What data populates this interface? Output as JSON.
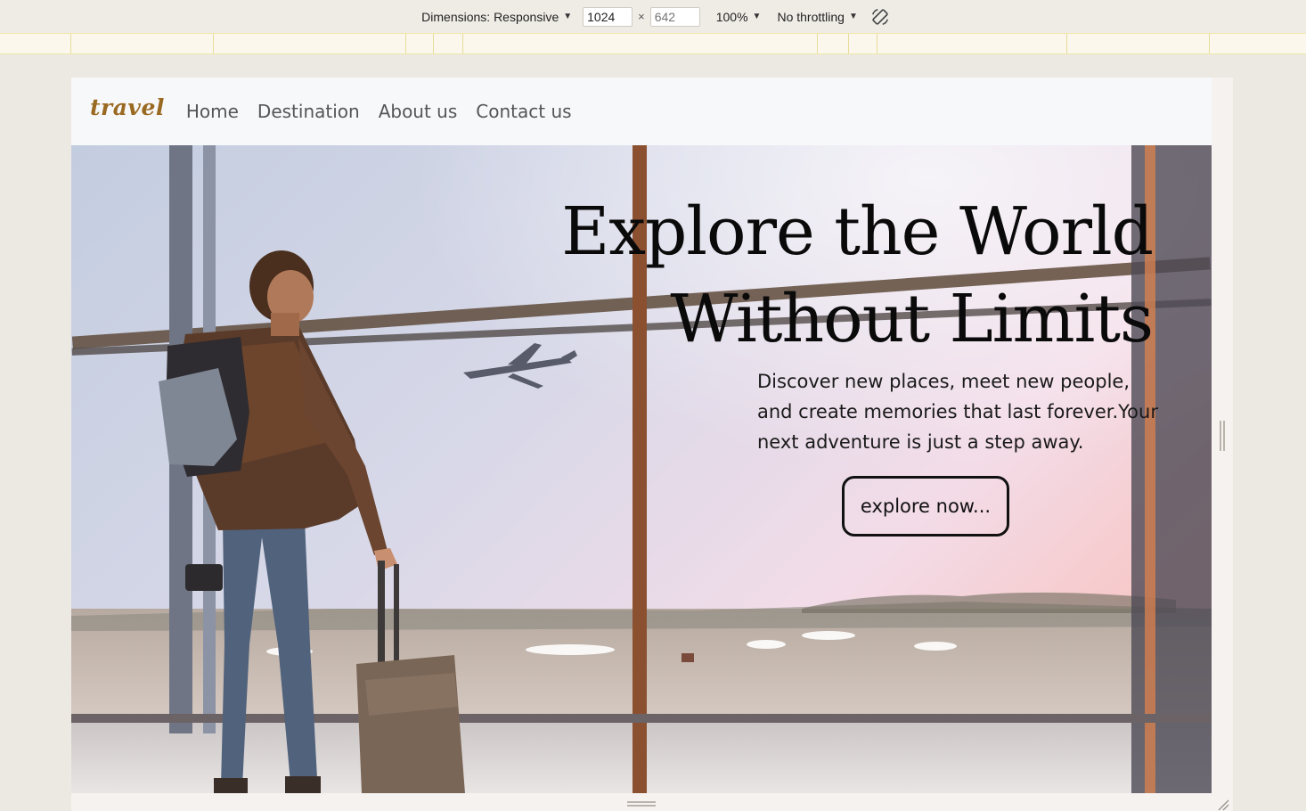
{
  "devtools": {
    "dimensions_label": "Dimensions: Responsive",
    "width_value": "1024",
    "height_value": "642",
    "times": "×",
    "zoom": "100%",
    "throttling": "No throttling"
  },
  "site": {
    "brand": "travel",
    "nav": [
      "Home",
      "Destination",
      "About us",
      "Contact us"
    ],
    "hero": {
      "headline_line1": "Explore the World",
      "headline_line2": "Without Limits",
      "subtext": "Discover new places, meet new people, and create memories that last forever.Your next adventure is just a step away.",
      "cta": "explore now..."
    }
  },
  "colors": {
    "brand": "#9a6a22",
    "nav_text": "#555555",
    "nav_bg": "#f7f8fa",
    "devtools_bg": "#efece6",
    "ruler_bg": "#fbf7ec"
  },
  "icons": [
    "caret-down-icon",
    "rotate-icon",
    "resize-handle-icon"
  ]
}
